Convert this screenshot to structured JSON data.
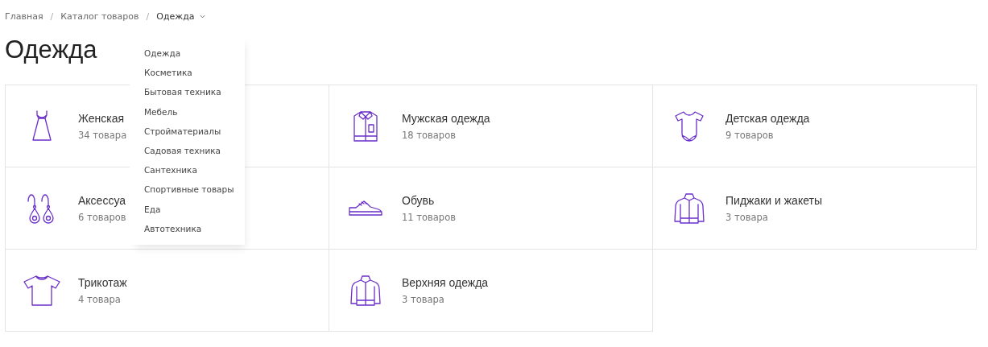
{
  "breadcrumbs": {
    "separator": "/",
    "items": [
      {
        "label": "Главная",
        "current": false
      },
      {
        "label": "Каталог товаров",
        "current": false
      },
      {
        "label": "Одежда",
        "current": true,
        "expanded": true
      }
    ]
  },
  "title": "Одежда",
  "dropdown": {
    "items": [
      {
        "label": "Одежда"
      },
      {
        "label": "Косметика"
      },
      {
        "label": "Бытовая техника"
      },
      {
        "label": "Мебель"
      },
      {
        "label": "Стройматериалы"
      },
      {
        "label": "Садовая техника"
      },
      {
        "label": "Сантехника"
      },
      {
        "label": "Спортивные товары"
      },
      {
        "label": "Еда"
      },
      {
        "label": "Автотехника"
      }
    ]
  },
  "categories": [
    {
      "kind": "dress",
      "name": "Женская",
      "count": "34 товара"
    },
    {
      "kind": "shirt",
      "name": "Мужская одежда",
      "count": "18 товаров"
    },
    {
      "kind": "bodysuit",
      "name": "Детская одежда",
      "count": "9 товаров"
    },
    {
      "kind": "earrings",
      "name": "Аксессуа",
      "count": "6 товаров"
    },
    {
      "kind": "sneaker",
      "name": "Обувь",
      "count": "11 товаров"
    },
    {
      "kind": "jacket",
      "name": "Пиджаки и жакеты",
      "count": "3 товара"
    },
    {
      "kind": "tshirt",
      "name": "Трикотаж",
      "count": "4 товара"
    },
    {
      "kind": "jacket",
      "name": "Верхняя одежда",
      "count": "3 товара"
    }
  ]
}
